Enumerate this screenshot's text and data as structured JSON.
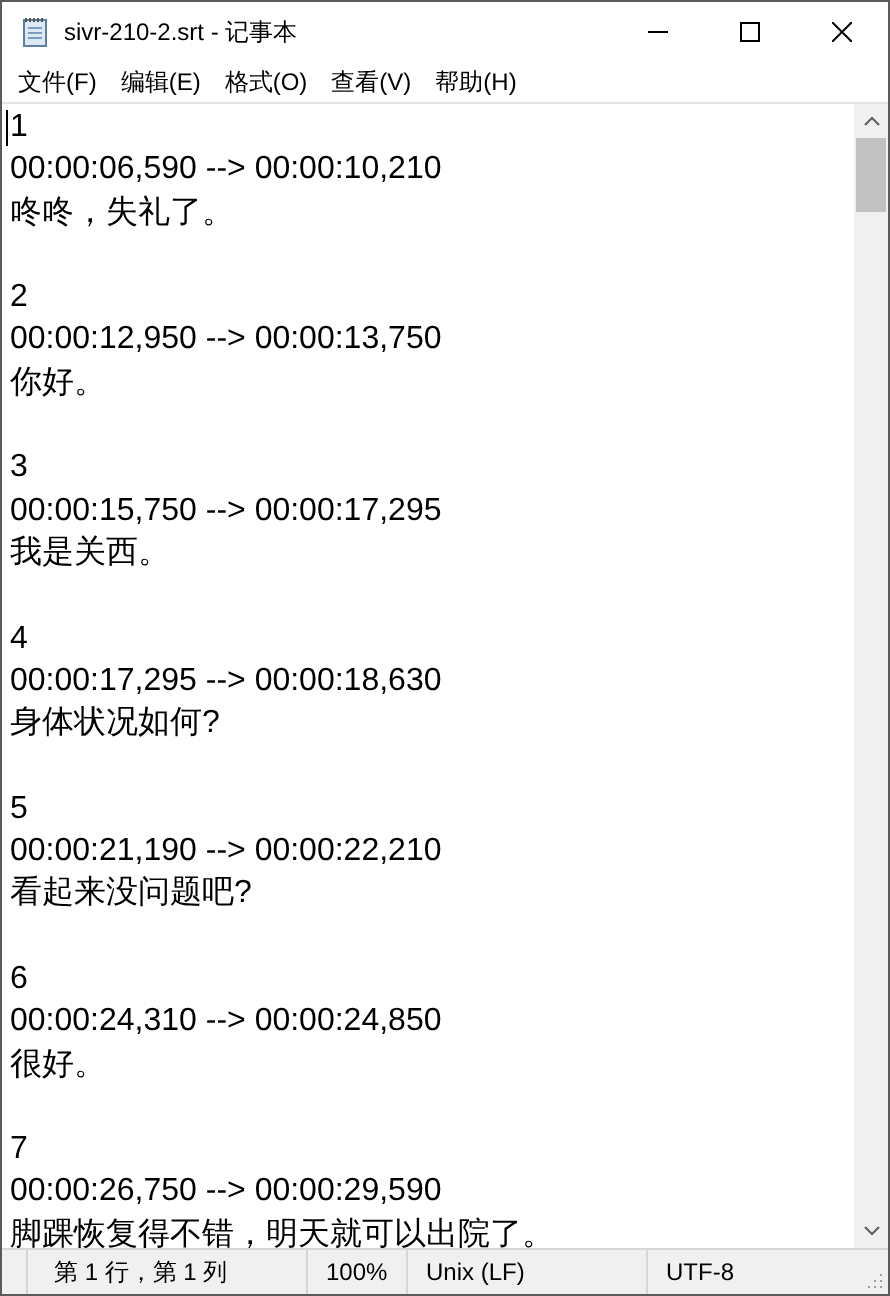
{
  "window": {
    "title": "sivr-210-2.srt - 记事本"
  },
  "menu": [
    "文件(F)",
    "编辑(E)",
    "格式(O)",
    "查看(V)",
    "帮助(H)"
  ],
  "subtitles": [
    {
      "index": "1",
      "timing": "00:00:06,590 --> 00:00:10,210",
      "text": "咚咚，失礼了。"
    },
    {
      "index": "2",
      "timing": "00:00:12,950 --> 00:00:13,750",
      "text": "你好。"
    },
    {
      "index": "3",
      "timing": "00:00:15,750 --> 00:00:17,295",
      "text": "我是关西。"
    },
    {
      "index": "4",
      "timing": "00:00:17,295 --> 00:00:18,630",
      "text": "身体状况如何?"
    },
    {
      "index": "5",
      "timing": "00:00:21,190 --> 00:00:22,210",
      "text": "看起来没问题吧?"
    },
    {
      "index": "6",
      "timing": "00:00:24,310 --> 00:00:24,850",
      "text": "很好。"
    },
    {
      "index": "7",
      "timing": "00:00:26,750 --> 00:00:29,590",
      "text": "脚踝恢复得不错，明天就可以出院了。"
    }
  ],
  "status_bar": {
    "position": "第 1 行，第 1 列",
    "zoom": "100%",
    "line_ending": "Unix (LF)",
    "encoding": "UTF-8"
  }
}
